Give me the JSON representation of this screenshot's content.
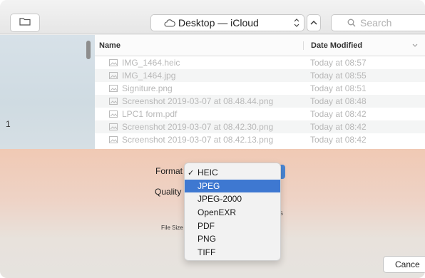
{
  "toolbar": {
    "location": "Desktop — iCloud",
    "search_placeholder": "Search"
  },
  "sidebar": {
    "fragment": "1"
  },
  "file_list": {
    "columns": {
      "name": "Name",
      "date": "Date Modified"
    },
    "rows": [
      {
        "name": "IMG_1464.heic",
        "date": "Today at 08:57"
      },
      {
        "name": "IMG_1464.jpg",
        "date": "Today at 08:55"
      },
      {
        "name": "Signiture.png",
        "date": "Today at 08:51"
      },
      {
        "name": "Screenshot 2019-03-07 at 08.48.44.png",
        "date": "Today at 08:48"
      },
      {
        "name": "LPC1 form.pdf",
        "date": "Today at 08:42"
      },
      {
        "name": "Screenshot 2019-03-07 at 08.42.30.png",
        "date": "Today at 08:42"
      },
      {
        "name": "Screenshot 2019-03-07 at 08.42.13.png",
        "date": "Today at 08:42"
      }
    ]
  },
  "options": {
    "format_label": "Format",
    "quality_label": "Quality",
    "file_size_label": "File Size",
    "s_fragment": "s",
    "cancel_label": "Cance"
  },
  "format_menu": {
    "checked": "HEIC",
    "highlighted": "JPEG",
    "items": [
      "HEIC",
      "JPEG",
      "JPEG-2000",
      "OpenEXR",
      "PDF",
      "PNG",
      "TIFF"
    ]
  },
  "colors": {
    "accent": "#3e78d1",
    "options_gradient_top": "#f0c9b4"
  }
}
